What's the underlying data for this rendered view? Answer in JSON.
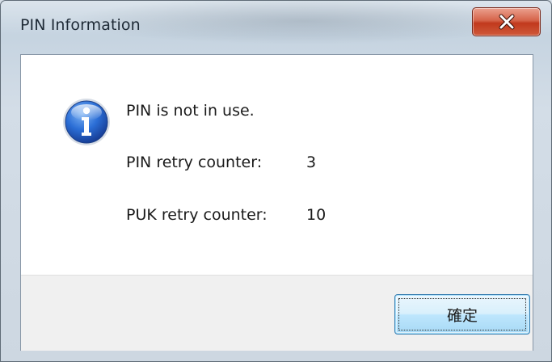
{
  "window": {
    "title": "PIN Information",
    "close_icon": "close-x-icon",
    "accent_close": "#c8412a"
  },
  "message": {
    "icon": "information-icon",
    "line1": "PIN is not in use.",
    "pin_retry_label": "PIN retry counter:",
    "pin_retry_value": "3",
    "puk_retry_label": "PUK retry counter:",
    "puk_retry_value": "10"
  },
  "buttons": {
    "ok_label": "確定"
  }
}
